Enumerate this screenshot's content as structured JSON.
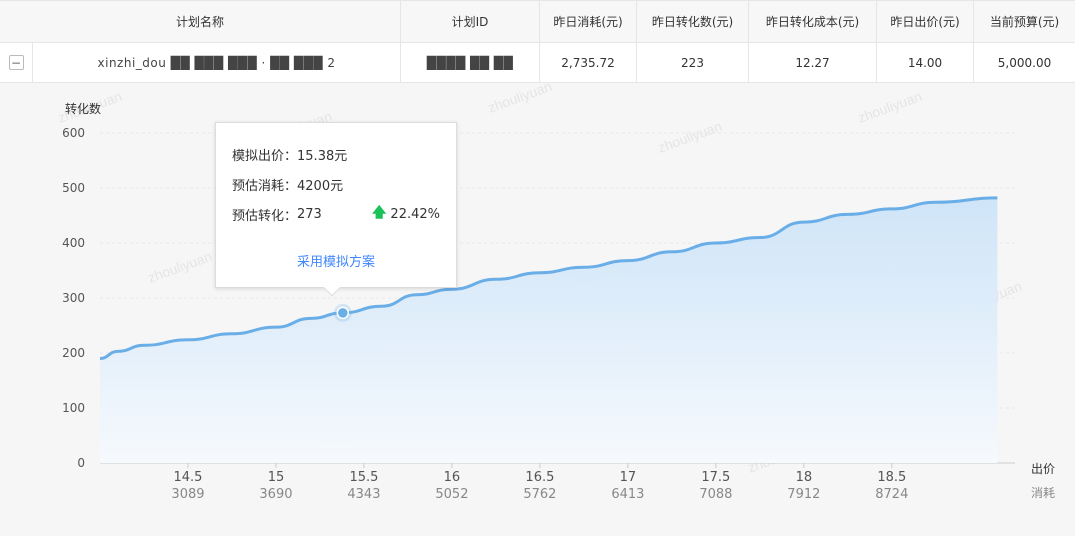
{
  "table": {
    "columns": [
      "计划名称",
      "计划ID",
      "昨日消耗(元)",
      "昨日转化数(元)",
      "昨日转化成本(元)",
      "昨日出价(元)",
      "当前预算(元)"
    ],
    "row": {
      "expand_symbol": "−",
      "plan_name": "xinzhi_dou ██ ███ ███ · ██ ███ 2",
      "plan_id": "████ ██ ██",
      "spend": "2,735.72",
      "conversions": "223",
      "conversion_cost": "12.27",
      "bid": "14.00",
      "budget": "5,000.00"
    }
  },
  "watermark_text": "zhouliyuan",
  "chart_data": {
    "type": "area",
    "ylabel": "转化数",
    "xlabel": "出价",
    "x2label": "消耗",
    "ylim": [
      0,
      600
    ],
    "yticks": [
      0,
      100,
      200,
      300,
      400,
      500,
      600
    ],
    "xlim": [
      14.0,
      19.2
    ],
    "xticks": [
      {
        "bid": "14.5",
        "spend": "3089",
        "x": 14.5
      },
      {
        "bid": "15",
        "spend": "3690",
        "x": 15
      },
      {
        "bid": "15.5",
        "spend": "4343",
        "x": 15.5
      },
      {
        "bid": "16",
        "spend": "5052",
        "x": 16
      },
      {
        "bid": "16.5",
        "spend": "5762",
        "x": 16.5
      },
      {
        "bid": "17",
        "spend": "6413",
        "x": 17
      },
      {
        "bid": "17.5",
        "spend": "7088",
        "x": 17.5
      },
      {
        "bid": "18",
        "spend": "7912",
        "x": 18
      },
      {
        "bid": "18.5",
        "spend": "8724",
        "x": 18.5
      }
    ],
    "series": [
      {
        "x": [
          14.0,
          14.1,
          14.25,
          14.5,
          14.75,
          15.0,
          15.2,
          15.38,
          15.6,
          15.8,
          16.0,
          16.25,
          16.5,
          16.75,
          17.0,
          17.25,
          17.5,
          17.75,
          18.0,
          18.25,
          18.5,
          18.75,
          19.1
        ],
        "y": [
          190,
          203,
          214,
          224,
          235,
          247,
          263,
          273,
          285,
          306,
          316,
          334,
          346,
          356,
          368,
          384,
          400,
          410,
          438,
          452,
          462,
          474,
          482
        ]
      }
    ],
    "highlight": {
      "x": 15.38,
      "y": 273
    },
    "grid": true,
    "color": "#6aaee8",
    "fill_top": "#cde4f8",
    "fill_bottom": "#f6f9fd"
  },
  "tooltip": {
    "bid_label": "模拟出价：",
    "bid_value": "15.38元",
    "spend_label": "预估消耗：",
    "spend_value": "4200元",
    "conv_label": "预估转化：",
    "conv_value": "273",
    "change_value": "22.42%",
    "action_label": "采用模拟方案"
  }
}
